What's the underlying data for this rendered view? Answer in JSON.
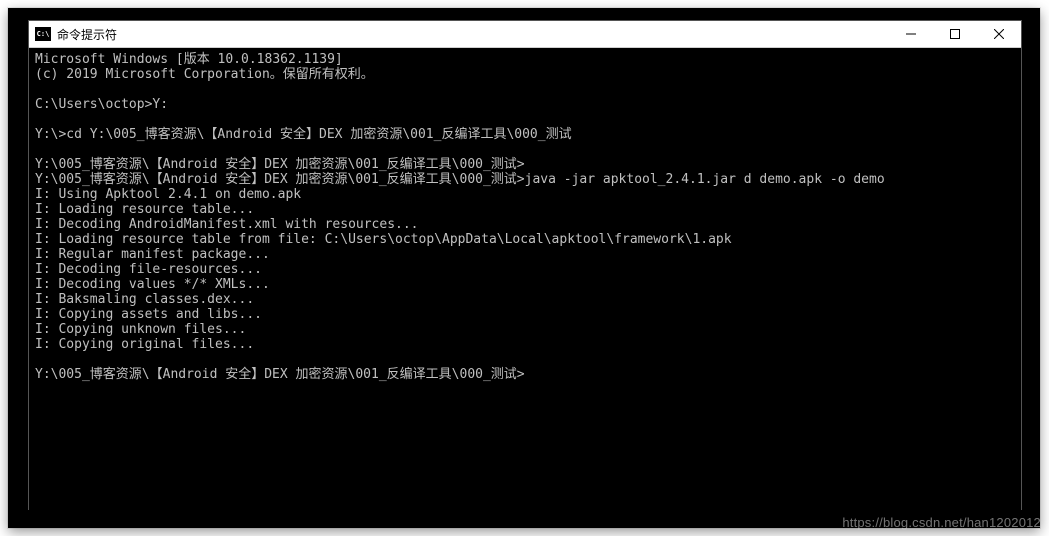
{
  "window": {
    "title": "命令提示符",
    "icon_label": "C:\\"
  },
  "terminal": {
    "lines": [
      "Microsoft Windows [版本 10.0.18362.1139]",
      "(c) 2019 Microsoft Corporation。保留所有权利。",
      "",
      "C:\\Users\\octop>Y:",
      "",
      "Y:\\>cd Y:\\005_博客资源\\【Android 安全】DEX 加密资源\\001_反编译工具\\000_测试",
      "",
      "Y:\\005_博客资源\\【Android 安全】DEX 加密资源\\001_反编译工具\\000_测试>",
      "Y:\\005_博客资源\\【Android 安全】DEX 加密资源\\001_反编译工具\\000_测试>java -jar apktool_2.4.1.jar d demo.apk -o demo",
      "I: Using Apktool 2.4.1 on demo.apk",
      "I: Loading resource table...",
      "I: Decoding AndroidManifest.xml with resources...",
      "I: Loading resource table from file: C:\\Users\\octop\\AppData\\Local\\apktool\\framework\\1.apk",
      "I: Regular manifest package...",
      "I: Decoding file-resources...",
      "I: Decoding values */* XMLs...",
      "I: Baksmaling classes.dex...",
      "I: Copying assets and libs...",
      "I: Copying unknown files...",
      "I: Copying original files...",
      "",
      "Y:\\005_博客资源\\【Android 安全】DEX 加密资源\\001_反编译工具\\000_测试>"
    ]
  },
  "watermark": "https://blog.csdn.net/han1202012"
}
